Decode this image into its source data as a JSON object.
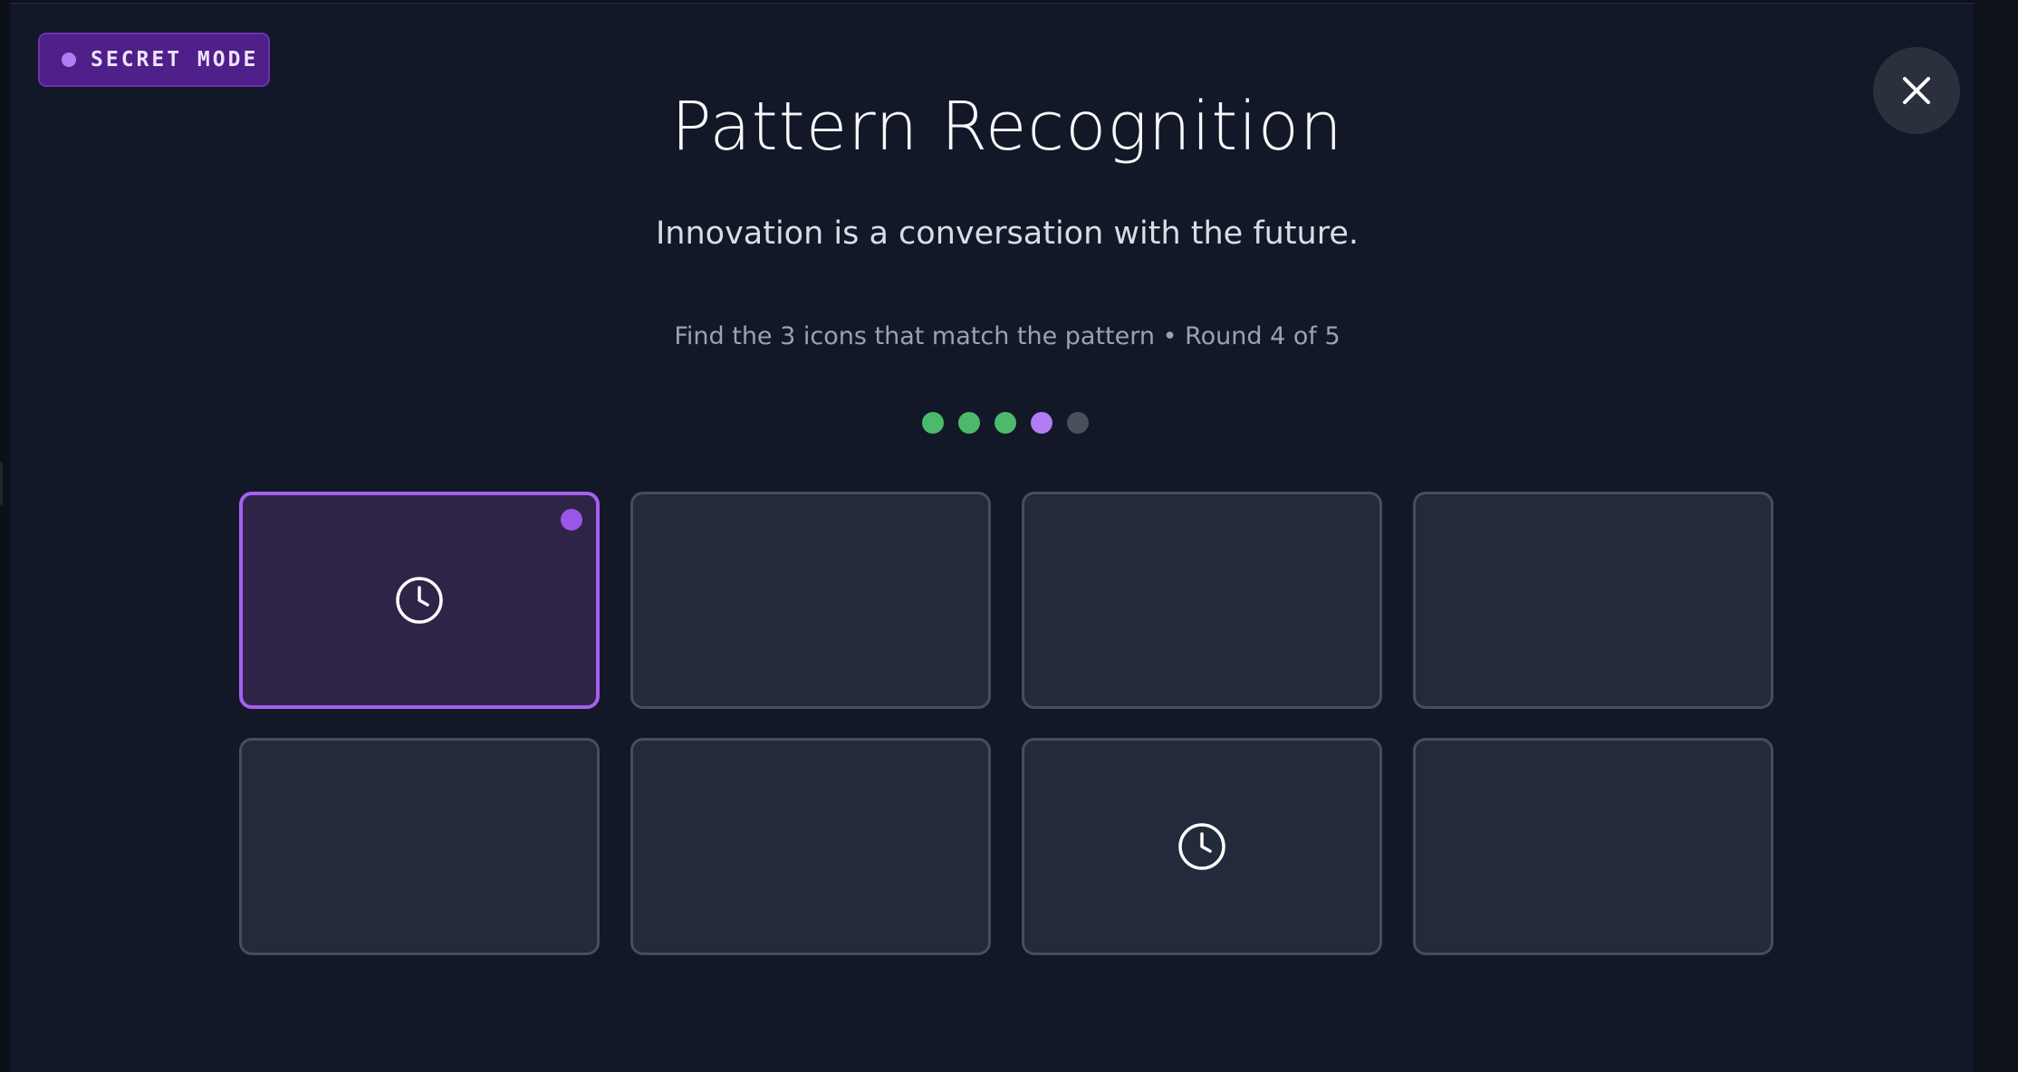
{
  "badge": {
    "label": "SECRET MODE",
    "color": "#4f1f8a"
  },
  "close": {
    "icon": "close-icon"
  },
  "header": {
    "title": "Pattern Recognition",
    "tagline": "Innovation is a conversation with the future.",
    "instructions": "Find the 3 icons that match the pattern • Round 4 of 5"
  },
  "progress": {
    "current_round": 4,
    "total_rounds": 5,
    "dots": [
      {
        "state": "complete",
        "color": "#4dba6b"
      },
      {
        "state": "complete",
        "color": "#4dba6b"
      },
      {
        "state": "complete",
        "color": "#4dba6b"
      },
      {
        "state": "current",
        "color": "#b27cf2"
      },
      {
        "state": "pending",
        "color": "#4a4f5c"
      }
    ]
  },
  "grid": {
    "tiles": [
      {
        "icon": "clock-icon",
        "selected": true
      },
      {
        "icon": "",
        "selected": false
      },
      {
        "icon": "",
        "selected": false
      },
      {
        "icon": "",
        "selected": false
      },
      {
        "icon": "",
        "selected": false
      },
      {
        "icon": "",
        "selected": false
      },
      {
        "icon": "clock-icon",
        "selected": false
      },
      {
        "icon": "",
        "selected": false
      }
    ]
  },
  "colors": {
    "background": "#121827",
    "accent": "#a65ff0",
    "tile": "#232a3b",
    "tile_border": "#454d5e",
    "success": "#4dba6b"
  }
}
